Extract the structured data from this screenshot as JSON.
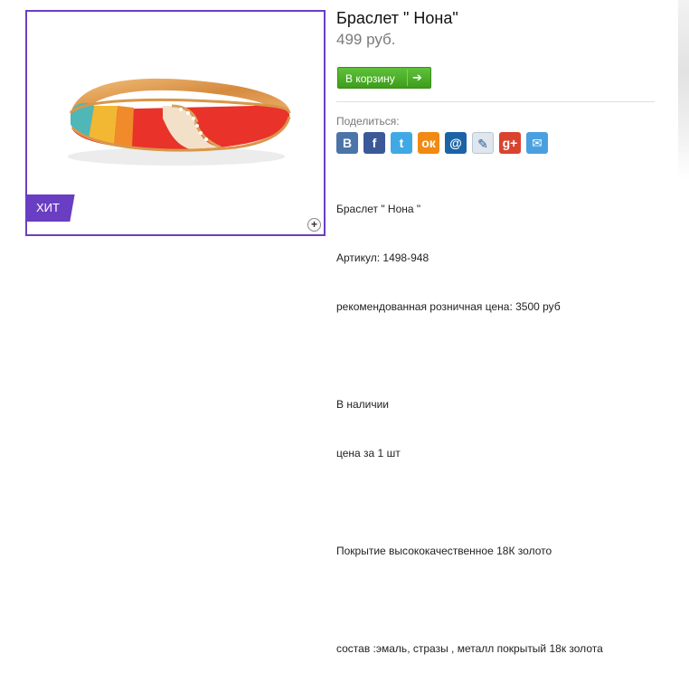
{
  "product": {
    "title": "Браслет \" Нона\"",
    "price": "499 руб.",
    "badge": "ХИТ",
    "cart_button": "В корзину"
  },
  "share": {
    "label": "Поделиться:",
    "icons": [
      {
        "name": "vk-icon",
        "glyph": "В",
        "color": "#4b74a8"
      },
      {
        "name": "facebook-icon",
        "glyph": "f",
        "color": "#3b5998"
      },
      {
        "name": "twitter-icon",
        "glyph": "t",
        "color": "#3fa9e6"
      },
      {
        "name": "odnoklassniki-icon",
        "glyph": "ок",
        "color": "#f08a12"
      },
      {
        "name": "mailru-icon",
        "glyph": "@",
        "color": "#1b63a6"
      },
      {
        "name": "livejournal-icon",
        "glyph": "✎",
        "color": "#dfe6ee"
      },
      {
        "name": "googleplus-icon",
        "glyph": "g+",
        "color": "#d9442f"
      },
      {
        "name": "email-icon",
        "glyph": "✉",
        "color": "#4aa0df"
      }
    ]
  },
  "description": {
    "line1": "Браслет \" Нона \"",
    "line2": "Артикул: 1498-948",
    "line3": "рекомендованная розничная цена: 3500 руб",
    "line4": "В наличии",
    "line5": "цена за 1 шт",
    "line6": "Покрытие высококачественное 18К золото",
    "line7": "состав :эмаль, стразы , металл покрытый 18к золота"
  }
}
